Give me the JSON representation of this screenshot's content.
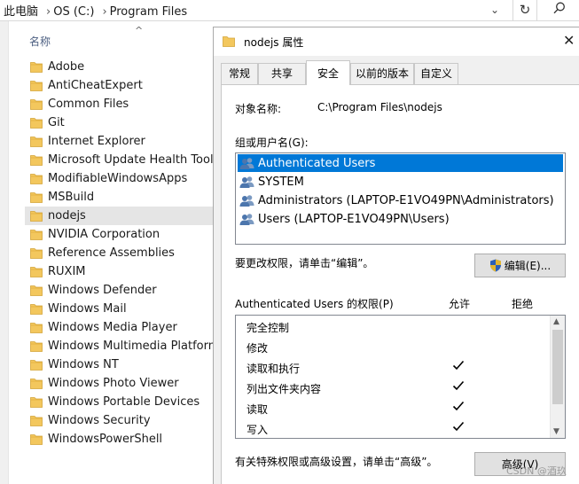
{
  "explorer": {
    "breadcrumbs": [
      "此电脑",
      "OS (C:)",
      "Program Files"
    ],
    "column_header": "名称",
    "selected_index": 8,
    "folders": [
      "Adobe",
      "AntiCheatExpert",
      "Common Files",
      "Git",
      "Internet Explorer",
      "Microsoft Update Health Tools",
      "ModifiableWindowsApps",
      "MSBuild",
      "nodejs",
      "NVIDIA Corporation",
      "Reference Assemblies",
      "RUXIM",
      "Windows Defender",
      "Windows Mail",
      "Windows Media Player",
      "Windows Multimedia Platform",
      "Windows NT",
      "Windows Photo Viewer",
      "Windows Portable Devices",
      "Windows Security",
      "WindowsPowerShell"
    ]
  },
  "dialog": {
    "title": "nodejs 属性",
    "tabs": [
      "常规",
      "共享",
      "安全",
      "以前的版本",
      "自定义"
    ],
    "active_tab": 2,
    "object_label": "对象名称:",
    "object_value": "C:\\Program Files\\nodejs",
    "group_label": "组或用户名(G):",
    "users": [
      "Authenticated Users",
      "SYSTEM",
      "Administrators (LAPTOP-E1VO49PN\\Administrators)",
      "Users (LAPTOP-E1VO49PN\\Users)"
    ],
    "selected_user": 0,
    "change_hint": "要更改权限，请单击“编辑”。",
    "edit_button": "编辑(E)...",
    "perm_title": "Authenticated Users 的权限(P)",
    "allow_label": "允许",
    "deny_label": "拒绝",
    "permissions": [
      {
        "name": "完全控制",
        "allow": false
      },
      {
        "name": "修改",
        "allow": false
      },
      {
        "name": "读取和执行",
        "allow": true
      },
      {
        "name": "列出文件夹内容",
        "allow": true
      },
      {
        "name": "读取",
        "allow": true
      },
      {
        "name": "写入",
        "allow": true
      }
    ],
    "advanced_hint": "有关特殊权限或高级设置，请单击“高级”。",
    "advanced_button": "高级(V)",
    "close_glyph": "✕"
  },
  "watermark": "CSDN @酒玖",
  "icons": {
    "folder": "folder-icon",
    "users": "users-icon",
    "shield": "uac-shield-icon",
    "refresh": "refresh-icon",
    "search": "search-icon"
  },
  "colors": {
    "selection_blue": "#0078d7",
    "folder_yellow": "#f3c75d",
    "dialog_bg": "#f0f0f0"
  }
}
